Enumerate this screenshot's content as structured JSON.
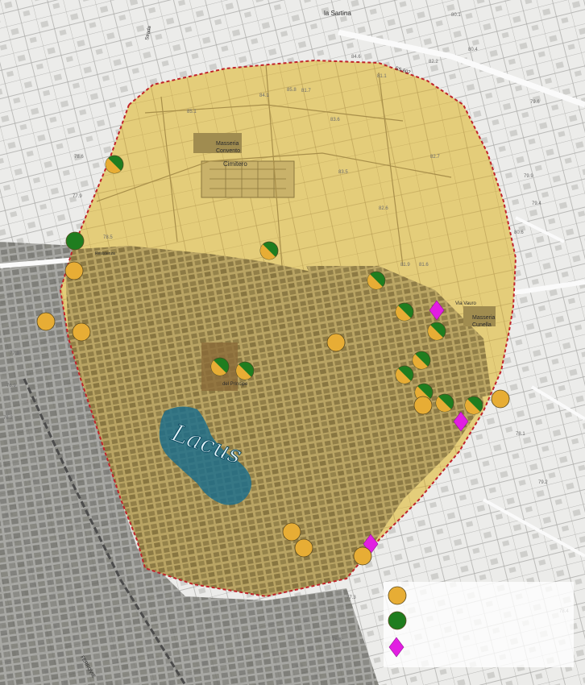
{
  "map": {
    "place_labels": {
      "sartina": "la Sartina",
      "masseria_convento": "Masseria\nConvento",
      "cimitero": "Cimitero",
      "masseria_cunella": "Masseria\nCunella",
      "palazzo": "del Principe",
      "lacus": "Lacus",
      "ferrovie": "FERROVIE",
      "strada": "Strada",
      "via_vauro": "Via Vauro",
      "resistenza": "Resistenza",
      "sp": "SS.607"
    },
    "elevations": [
      "84.6",
      "82.2",
      "81.7",
      "81.1",
      "80.4",
      "79.9",
      "79.4",
      "78.6",
      "78.5",
      "77.9",
      "77.1",
      "76.9",
      "76.2",
      "79.2",
      "78.1",
      "77.3",
      "80.1",
      "83.6",
      "82.7",
      "81.9",
      "82.6",
      "85.8",
      "84.1",
      "83.5",
      "81.6",
      "85.1",
      "80.6",
      "76.8",
      "79.6",
      "78.4"
    ],
    "legend": {
      "entries": [
        {
          "symbol": "orange-circle",
          "label": ""
        },
        {
          "symbol": "green-circle",
          "label": ""
        },
        {
          "symbol": "magenta-diamond",
          "label": ""
        }
      ]
    },
    "colors": {
      "area_fill": "#e3c76a",
      "boundary": "#c0232a",
      "orange": "#e7ad35",
      "green": "#1f7d1f",
      "magenta": "#e21ee2",
      "lake": "#1a6c8c"
    }
  }
}
